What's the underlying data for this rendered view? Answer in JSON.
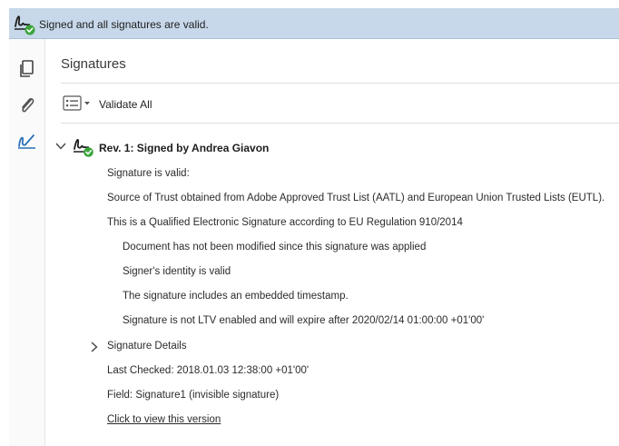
{
  "banner": {
    "text": "Signed and all signatures are valid."
  },
  "leftbar": {
    "tools": [
      "pages-icon",
      "attachment-icon",
      "signature-panel-icon"
    ]
  },
  "panel": {
    "title": "Signatures",
    "toolbar": {
      "validate_label": "Validate All"
    },
    "revision": {
      "title": "Rev. 1: Signed by Andrea Giavon",
      "lines": [
        "Signature is valid:",
        "Source of Trust obtained from Adobe Approved Trust List (AATL) and European Union Trusted Lists (EUTL).",
        "This is a Qualified Electronic Signature according to EU Regulation 910/2014"
      ],
      "sublines": [
        "Document has not been modified since this signature was applied",
        "Signer's identity is valid",
        "The signature includes an embedded timestamp.",
        "Signature is not LTV enabled and will expire after 2020/02/14 01:00:00 +01'00'"
      ],
      "details_label": "Signature Details",
      "last_checked": "Last Checked: 2018.01.03 12:38:00 +01'00'",
      "field": "Field: Signature1 (invisible signature)",
      "view_link": "Click to view this version"
    }
  },
  "colors": {
    "banner_bg": "#c7d8ea",
    "valid_green": "#3aa43a",
    "accent_blue": "#2a6fb5"
  }
}
